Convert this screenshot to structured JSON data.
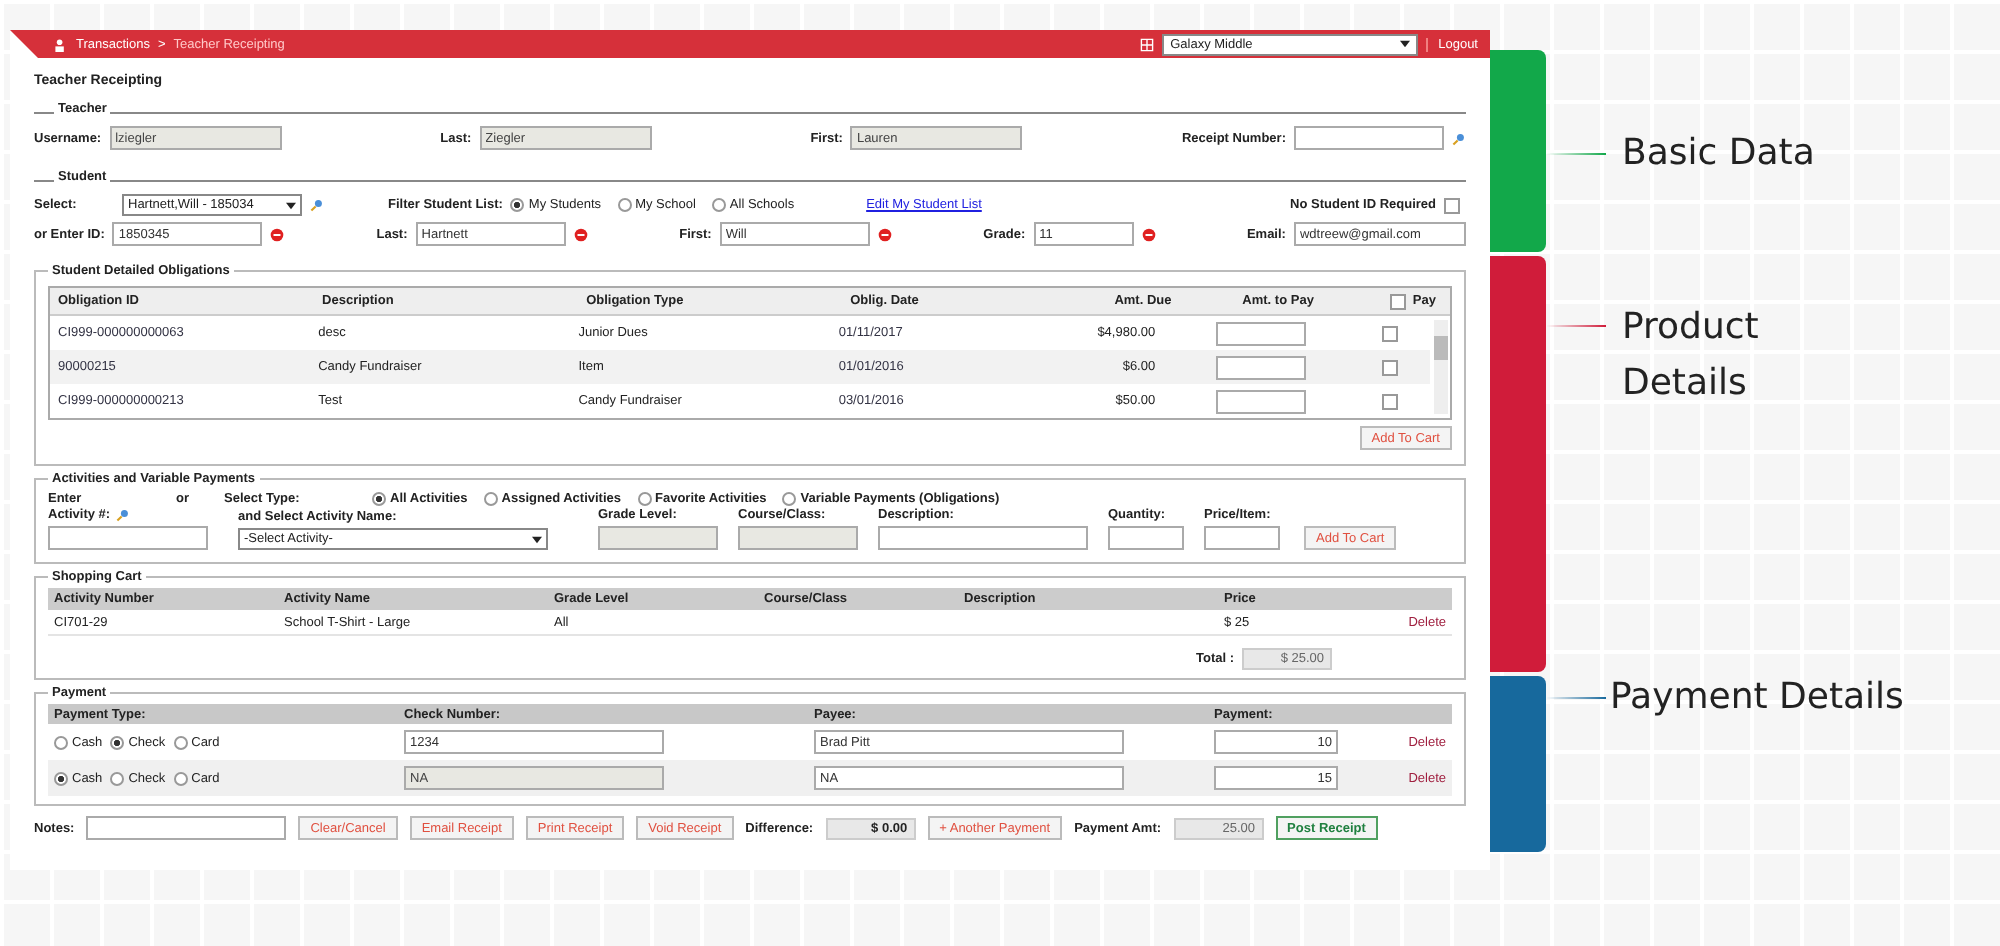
{
  "header": {
    "breadcrumb": [
      "Transactions",
      "Teacher Receipting"
    ],
    "separator": ">",
    "school": "Galaxy Middle",
    "logout": "Logout"
  },
  "page_title": "Teacher Receipting",
  "teacher": {
    "legend": "Teacher",
    "fields": [
      {
        "label": "Username:",
        "value": "lziegler",
        "disabled": true,
        "lookup": false
      },
      {
        "label": "Last:",
        "value": "Ziegler",
        "disabled": true,
        "lookup": false
      },
      {
        "label": "First:",
        "value": "Lauren",
        "disabled": true,
        "lookup": false
      },
      {
        "label": "Receipt Number:",
        "disabled": false,
        "lookup": true
      }
    ]
  },
  "student": {
    "legend": "Student",
    "select_label": "Select:",
    "select_value": "Hartnett,Will - 185034",
    "filter_label": "Filter Student List:",
    "filters": [
      {
        "label": "My Students",
        "selected": true
      },
      {
        "label": "My School",
        "selected": false
      },
      {
        "label": "All Schools",
        "selected": false
      }
    ],
    "link": "Edit My Student List",
    "no_id": {
      "label": "No Student ID Required",
      "checked": false
    },
    "fields": [
      {
        "label": "or Enter ID:",
        "value": "1850345",
        "clear": true
      },
      {
        "label": "Last:",
        "value": "Hartnett",
        "clear": true
      },
      {
        "label": "First:",
        "value": "Will",
        "clear": true
      },
      {
        "label": "Grade:",
        "value": "11",
        "clear": true
      },
      {
        "label": "Email:",
        "value": "wdtreew@gmail.com",
        "clear": false
      }
    ]
  },
  "obligations": {
    "legend": "Student Detailed Obligations",
    "columns": [
      "Obligation ID",
      "Description",
      "Obligation Type",
      "Oblig. Date",
      "Amt. Due",
      "Amt. to Pay",
      "Pay"
    ],
    "pay_all": false,
    "rows": [
      {
        "id": "CI999-000000000063",
        "description": "desc",
        "type": "Junior Dues",
        "date": "01/11/2017",
        "due": "$4,980.00",
        "pay": false
      },
      {
        "id": "90000215",
        "description": "Candy Fundraiser",
        "type": "Item",
        "date": "01/01/2016",
        "due": "$6.00",
        "pay": false
      },
      {
        "id": "CI999-000000000213",
        "description": "Test",
        "type": "Candy Fundraiser",
        "date": "03/01/2016",
        "due": "$50.00",
        "pay": false
      }
    ],
    "button": "Add To Cart"
  },
  "activities": {
    "legend": "Activities and Variable Payments",
    "enter": "Enter",
    "or": "or",
    "select_type": "Select Type:",
    "types": [
      {
        "label": "All Activities",
        "selected": true
      },
      {
        "label": "Assigned Activities",
        "selected": false
      },
      {
        "label": "Favorite Activities",
        "selected": false
      },
      {
        "label": "Variable Payments (Obligations)",
        "selected": false
      }
    ],
    "activity_label": "Activity #:",
    "name_label": "and Select Activity Name:",
    "activity_select": "-Select Activity-",
    "fields": [
      {
        "label": "Grade Level:",
        "disabled": true
      },
      {
        "label": "Course/Class:",
        "disabled": true
      },
      {
        "label": "Description:",
        "disabled": false
      },
      {
        "label": "Quantity:",
        "disabled": false
      },
      {
        "label": "Price/Item:",
        "disabled": false
      }
    ],
    "button": "Add To Cart"
  },
  "cart": {
    "legend": "Shopping Cart",
    "columns": [
      "Activity Number",
      "Activity Name",
      "Grade Level",
      "Course/Class",
      "Description",
      "Price"
    ],
    "rows": [
      {
        "number": "CI701-29",
        "name": "School T-Shirt - Large",
        "grade": "All",
        "price": "$ 25",
        "delete": "Delete"
      }
    ],
    "total_label": "Total :",
    "total": "$ 25.00"
  },
  "payment": {
    "legend": "Payment",
    "columns": [
      "Payment Type:",
      "Check Number:",
      "Payee:",
      "Payment:"
    ],
    "rows": [
      {
        "types": [
          {
            "label": "Cash",
            "selected": false
          },
          {
            "label": "Check",
            "selected": true
          },
          {
            "label": "Card",
            "selected": false
          }
        ],
        "check": "1234",
        "check_disabled": false,
        "payee": "Brad Pitt",
        "amount": "10",
        "delete": "Delete"
      },
      {
        "types": [
          {
            "label": "Cash",
            "selected": true
          },
          {
            "label": "Check",
            "selected": false
          },
          {
            "label": "Card",
            "selected": false
          }
        ],
        "check": "NA",
        "check_disabled": true,
        "payee": "NA",
        "amount": "15",
        "delete": "Delete"
      }
    ]
  },
  "footer": {
    "notes_label": "Notes:",
    "buttons": [
      "Clear/Cancel",
      "Email Receipt",
      "Print Receipt",
      "Void Receipt"
    ],
    "difference_label": "Difference:",
    "difference": "$ 0.00",
    "another": "+ Another Payment",
    "amount_label": "Payment Amt:",
    "amount": "25.00",
    "post": "Post Receipt"
  },
  "annotations": [
    {
      "label": "Basic Data",
      "color": "#12a84a"
    },
    {
      "label": "Product Details",
      "color": "#d01c3a"
    },
    {
      "label": "Payment Details",
      "color": "#17699d"
    }
  ]
}
